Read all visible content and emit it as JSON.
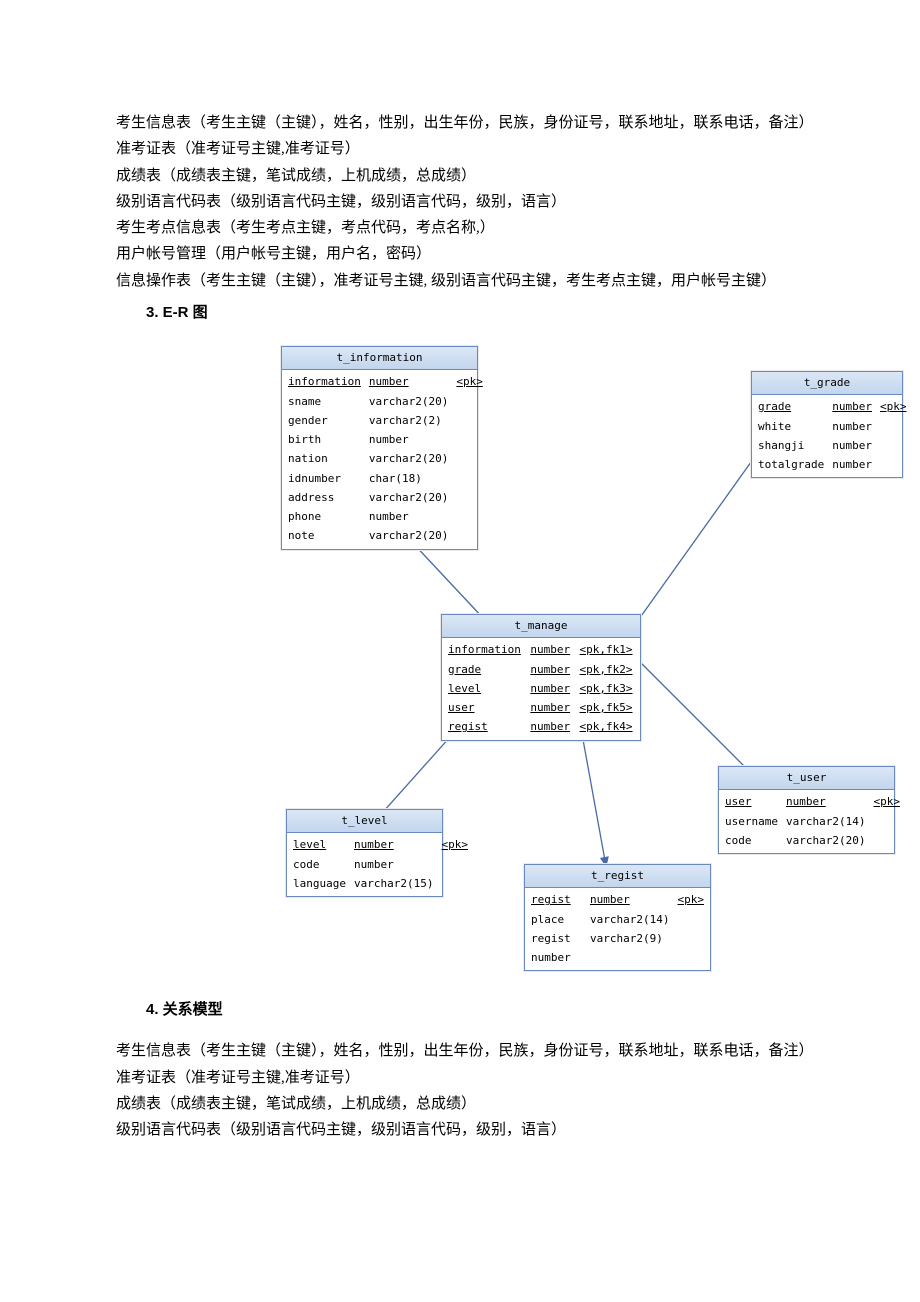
{
  "section_top": {
    "line1": "考生信息表（考生主键（主键），姓名，性别，出生年份，民族，身份证号，联系地址，联系电话，备注）",
    "line2": "准考证表（准考证号主键,准考证号）",
    "line3": "成绩表（成绩表主键，笔试成绩，上机成绩，总成绩）",
    "line4": "级别语言代码表（级别语言代码主键，级别语言代码，级别，语言）",
    "line5": "考生考点信息表（考生考点主键，考点代码，考点名称,）",
    "line6": "用户帐号管理（用户帐号主键，用户名，密码）",
    "line7": "信息操作表（考生主键（主键），准考证号主键, 级别语言代码主键，考生考点主键，用户帐号主键）"
  },
  "heading3": "3. E-R 图",
  "er": {
    "t_information": {
      "title": "t_information",
      "rows": [
        [
          "information",
          "number",
          "<pk>"
        ],
        [
          "sname",
          "varchar2(20)",
          ""
        ],
        [
          "gender",
          "varchar2(2)",
          ""
        ],
        [
          "birth",
          "number",
          ""
        ],
        [
          "nation",
          "varchar2(20)",
          ""
        ],
        [
          "idnumber",
          "char(18)",
          ""
        ],
        [
          "address",
          "varchar2(20)",
          ""
        ],
        [
          "phone",
          "number",
          ""
        ],
        [
          "note",
          "varchar2(20)",
          ""
        ]
      ]
    },
    "t_grade": {
      "title": "t_grade",
      "rows": [
        [
          "grade",
          "number",
          "<pk>"
        ],
        [
          "white",
          "number",
          ""
        ],
        [
          "shangji",
          "number",
          ""
        ],
        [
          "totalgrade",
          "number",
          ""
        ]
      ]
    },
    "t_manage": {
      "title": "t_manage",
      "rows": [
        [
          "information",
          "number",
          "<pk,fk1>"
        ],
        [
          "grade",
          "number",
          "<pk,fk2>"
        ],
        [
          "level",
          "number",
          "<pk,fk3>"
        ],
        [
          "user",
          "number",
          "<pk,fk5>"
        ],
        [
          "regist",
          "number",
          "<pk,fk4>"
        ]
      ]
    },
    "t_level": {
      "title": "t_level",
      "rows": [
        [
          "level",
          "number",
          "<pk>"
        ],
        [
          "code",
          "number",
          ""
        ],
        [
          "language",
          "varchar2(15)",
          ""
        ]
      ]
    },
    "t_user": {
      "title": "t_user",
      "rows": [
        [
          "user",
          "number",
          "<pk>"
        ],
        [
          "username",
          "varchar2(14)",
          ""
        ],
        [
          "code",
          "varchar2(20)",
          ""
        ]
      ]
    },
    "t_regist": {
      "title": "t_regist",
      "rows": [
        [
          "regist",
          "number",
          "<pk>"
        ],
        [
          "place",
          "varchar2(14)",
          ""
        ],
        [
          "regist number",
          "varchar2(9)",
          ""
        ]
      ]
    }
  },
  "heading4": "4. 关系模型",
  "section4": {
    "line1": "考生信息表（考生主键（主键），姓名，性别，出生年份，民族，身份证号，联系地址，联系电话，备注）",
    "line2": "准考证表（准考证号主键,准考证号）",
    "line3": "成绩表（成绩表主键，笔试成绩，上机成绩，总成绩）",
    "line4": "级别语言代码表（级别语言代码主键，级别语言代码，级别，语言）"
  }
}
